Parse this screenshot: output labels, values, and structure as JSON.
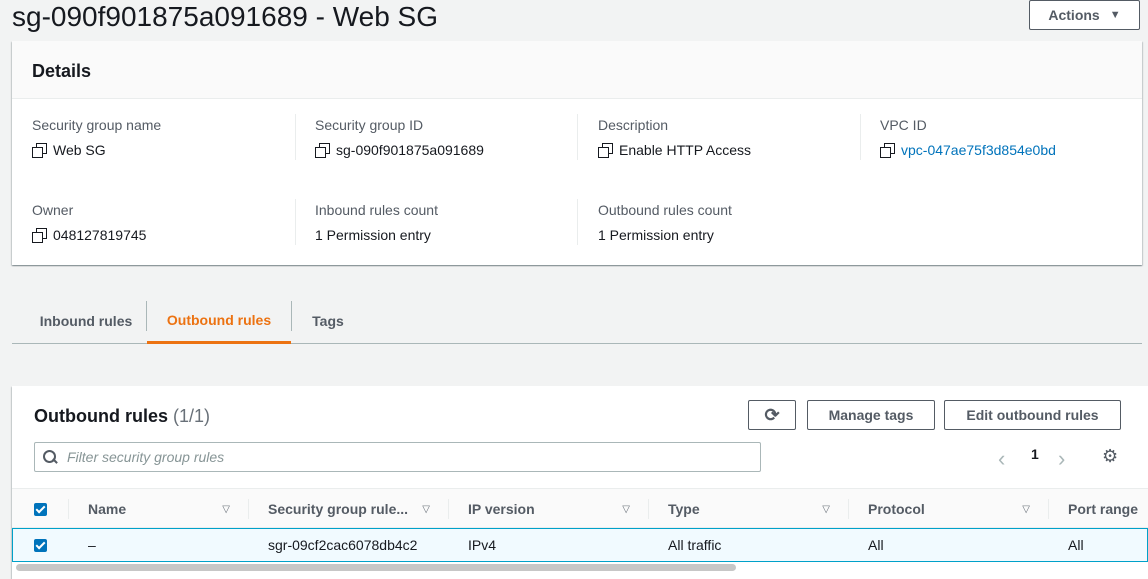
{
  "page": {
    "title": "sg-090f901875a091689 - Web SG"
  },
  "actions_label": "Actions",
  "details": {
    "header": "Details",
    "fields": {
      "sg_name": {
        "label": "Security group name",
        "value": "Web SG"
      },
      "sg_id": {
        "label": "Security group ID",
        "value": "sg-090f901875a091689"
      },
      "description": {
        "label": "Description",
        "value": "Enable HTTP Access"
      },
      "vpc_id": {
        "label": "VPC ID",
        "value": "vpc-047ae75f3d854e0bd"
      },
      "owner": {
        "label": "Owner",
        "value": "048127819745"
      },
      "inbound_count": {
        "label": "Inbound rules count",
        "value": "1 Permission entry"
      },
      "outbound_count": {
        "label": "Outbound rules count",
        "value": "1 Permission entry"
      }
    }
  },
  "tabs": {
    "inbound": "Inbound rules",
    "outbound": "Outbound rules",
    "tags": "Tags",
    "active": "outbound"
  },
  "rules": {
    "title": "Outbound rules",
    "count": "(1/1)",
    "manage_tags": "Manage tags",
    "edit_rules": "Edit outbound rules",
    "filter_placeholder": "Filter security group rules",
    "page_number": "1",
    "columns": {
      "name": "Name",
      "rule_id": "Security group rule...",
      "ip_version": "IP version",
      "type": "Type",
      "protocol": "Protocol",
      "port_range": "Port range"
    },
    "rows": [
      {
        "name": "–",
        "rule_id": "sgr-09cf2cac6078db4c2",
        "ip_version": "IPv4",
        "type": "All traffic",
        "protocol": "All",
        "port_range": "All",
        "selected": true
      }
    ]
  },
  "colors": {
    "accent": "#ec7211",
    "link": "#0073bb",
    "selected_row": "#f1faff"
  },
  "icons": [
    "copy-icon",
    "refresh-icon",
    "search-icon",
    "chevron-left-icon",
    "chevron-right-icon",
    "gear-icon",
    "sort-icon",
    "caret-down-icon",
    "checkbox-icon"
  ]
}
